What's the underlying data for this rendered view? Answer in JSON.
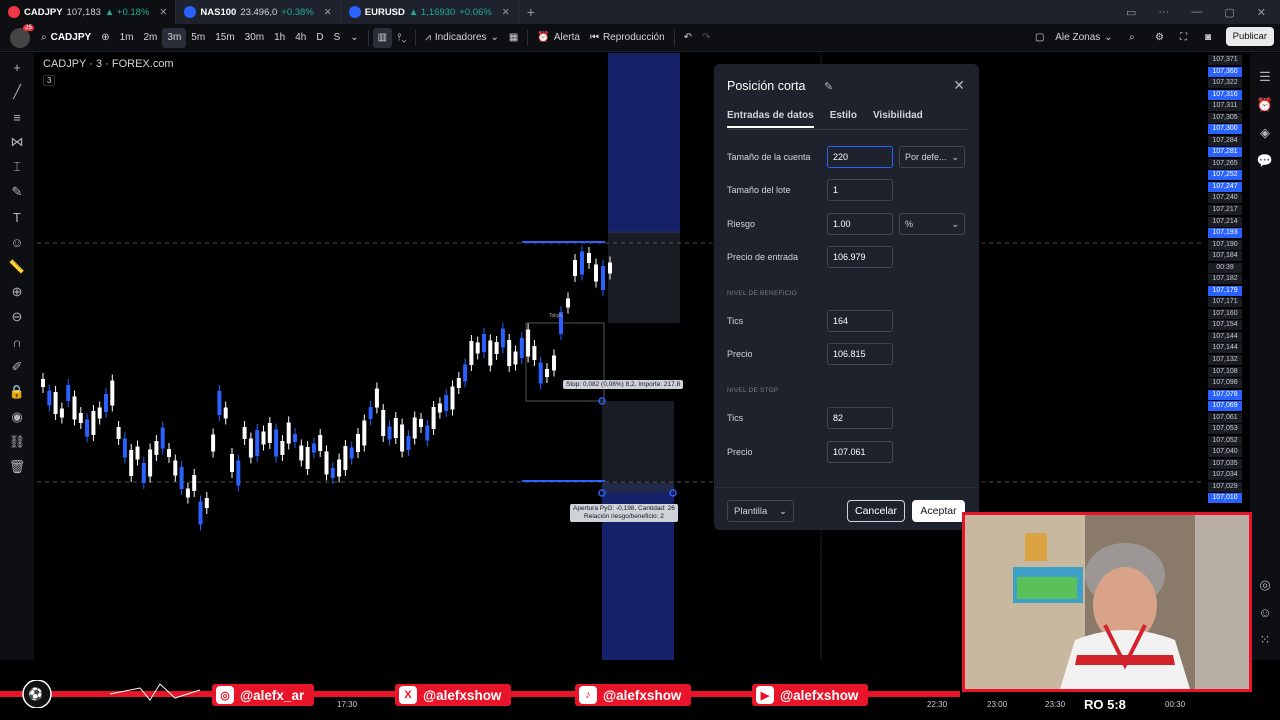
{
  "tabs": [
    {
      "symbol": "CADJPY",
      "price": "107,183",
      "change": "▲ +0.18%",
      "color": "#f23645"
    },
    {
      "symbol": "NAS100",
      "price": "23.496,0",
      "change": "+0.38%",
      "color": "#2962ff"
    },
    {
      "symbol": "EURUSD",
      "price": "▲ 1,16930",
      "change": "+0.06%",
      "color": "#2962ff"
    }
  ],
  "toolbar": {
    "notif_count": "25",
    "symbol": "CADJPY",
    "intervals": [
      "1m",
      "2m",
      "3m",
      "5m",
      "15m",
      "30m",
      "1h",
      "4h",
      "D",
      "S"
    ],
    "selected_interval": "3m",
    "indicators": "Indicadores",
    "alert": "Alerta",
    "replay": "Reproducción",
    "layout": "Ale Zonas",
    "publish": "Publicar"
  },
  "chart": {
    "title": "CADJPY · 3 · FOREX.com",
    "sub": "3",
    "tokyo": "Tokyo",
    "stop_tooltip": "Stop: 0,082 (0,08%) 8,2, Importe: 217.8",
    "pnl_tooltip_1": "Apertura PyG: -0,198, Cantidad: 26",
    "pnl_tooltip_2": "Relación riesgo/beneficio: 2"
  },
  "price_axis": [
    {
      "v": "107,371",
      "blue": false
    },
    {
      "v": "107,360",
      "blue": true
    },
    {
      "v": "107,322",
      "blue": false
    },
    {
      "v": "107,316",
      "blue": true
    },
    {
      "v": "107,311",
      "blue": false
    },
    {
      "v": "107,305",
      "blue": false
    },
    {
      "v": "107,300",
      "blue": true
    },
    {
      "v": "107,284",
      "blue": false
    },
    {
      "v": "107,281",
      "blue": true
    },
    {
      "v": "107,265",
      "blue": false
    },
    {
      "v": "107,252",
      "blue": true
    },
    {
      "v": "107,247",
      "blue": true
    },
    {
      "v": "107,240",
      "blue": false
    },
    {
      "v": "107,217",
      "blue": false
    },
    {
      "v": "107,214",
      "blue": false
    },
    {
      "v": "107,193",
      "blue": true
    },
    {
      "v": "107,190",
      "blue": false
    },
    {
      "v": "107,184",
      "blue": false
    },
    {
      "v": "00:39",
      "blue": false
    },
    {
      "v": "107,182",
      "blue": false
    },
    {
      "v": "107,179",
      "blue": true
    },
    {
      "v": "107,171",
      "blue": false
    },
    {
      "v": "107,160",
      "blue": false
    },
    {
      "v": "107,154",
      "blue": false
    },
    {
      "v": "107,144",
      "blue": false
    },
    {
      "v": "107,144",
      "blue": false
    },
    {
      "v": "107,132",
      "blue": false
    },
    {
      "v": "107,108",
      "blue": false
    },
    {
      "v": "107,098",
      "blue": false
    },
    {
      "v": "107,078",
      "blue": true
    },
    {
      "v": "107,069",
      "blue": true
    },
    {
      "v": "107,061",
      "blue": false
    },
    {
      "v": "107,053",
      "blue": false
    },
    {
      "v": "107,052",
      "blue": false
    },
    {
      "v": "107,040",
      "blue": false
    },
    {
      "v": "107,035",
      "blue": false
    },
    {
      "v": "107,034",
      "blue": false
    },
    {
      "v": "107,029",
      "blue": false
    },
    {
      "v": "107,010",
      "blue": true
    }
  ],
  "dialog": {
    "title": "Posición corta",
    "tab_inputs": "Entradas de datos",
    "tab_style": "Estilo",
    "tab_visibility": "Visibilidad",
    "account_label": "Tamaño de la cuenta",
    "account_value": "220",
    "account_unit": "Por defe...",
    "lot_label": "Tamaño del lote",
    "lot_value": "1",
    "risk_label": "Riesgo",
    "risk_value": "1.00",
    "risk_unit": "%",
    "entry_label": "Precio de entrada",
    "entry_value": "106.979",
    "profit_section": "NIVEL DE BENEFICIO",
    "profit_ticks_label": "Tics",
    "profit_ticks": "164",
    "profit_price_label": "Precio",
    "profit_price": "106.815",
    "stop_section": "NIVEL DE STOP",
    "stop_ticks_label": "Tics",
    "stop_ticks": "82",
    "stop_price_label": "Precio",
    "stop_price": "107.061",
    "template": "Plantilla",
    "cancel": "Cancelar",
    "accept": "Aceptar"
  },
  "social": [
    {
      "handle": "@alefx_ar",
      "icon": "instagram-icon",
      "glyph": "◎"
    },
    {
      "handle": "@alefxshow",
      "icon": "x-icon",
      "glyph": "X"
    },
    {
      "handle": "@alefxshow",
      "icon": "tiktok-icon",
      "glyph": "♪"
    },
    {
      "handle": "@alefxshow",
      "icon": "youtube-icon",
      "glyph": "▶"
    }
  ],
  "time_axis": [
    "17:30",
    "22:30",
    "23:00",
    "23:30",
    "00:30"
  ],
  "clock": "RO 5:8"
}
